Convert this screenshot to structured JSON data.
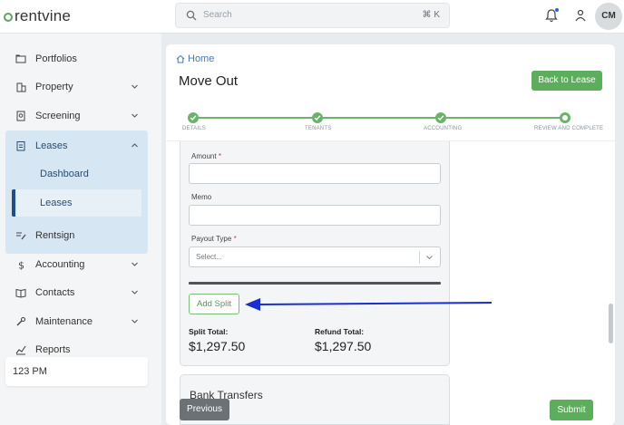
{
  "app": {
    "logo_text": "rentvine"
  },
  "search": {
    "placeholder": "Search",
    "shortcut": "⌘ K"
  },
  "user": {
    "initials": "CM"
  },
  "sidebar": {
    "items": [
      {
        "label": "Portfolios"
      },
      {
        "label": "Property"
      },
      {
        "label": "Screening"
      },
      {
        "label": "Leases"
      },
      {
        "label": "Rentsign"
      },
      {
        "label": "Accounting"
      },
      {
        "label": "Contacts"
      },
      {
        "label": "Maintenance"
      },
      {
        "label": "Reports"
      }
    ],
    "leases_sub": [
      {
        "label": "Dashboard"
      },
      {
        "label": "Leases"
      }
    ],
    "company": "123 PM"
  },
  "breadcrumb": {
    "home": "Home"
  },
  "page": {
    "title": "Move Out",
    "back_button": "Back to Lease"
  },
  "stepper": {
    "steps": [
      {
        "label": "DETAILS",
        "state": "complete"
      },
      {
        "label": "TENANTS",
        "state": "complete"
      },
      {
        "label": "ACCOUNTING",
        "state": "complete"
      },
      {
        "label": "REVIEW AND COMPLETE",
        "state": "current"
      }
    ]
  },
  "form": {
    "amount_label": "Amount",
    "memo_label": "Memo",
    "payout_type_label": "Payout Type",
    "required_mark": "*",
    "payout_placeholder": "Select...",
    "add_split_button": "Add Split",
    "split_total_label": "Split Total:",
    "split_total_value": "$1,297.50",
    "refund_total_label": "Refund Total:",
    "refund_total_value": "$1,297.50"
  },
  "bank_transfers": {
    "title": "Bank Transfers"
  },
  "footer": {
    "previous_button": "Previous",
    "submit_button": "Submit"
  },
  "colors": {
    "accent_green": "#5cae5c",
    "annotation_arrow": "#1a2fd1",
    "link_blue": "#3d7ab8"
  }
}
